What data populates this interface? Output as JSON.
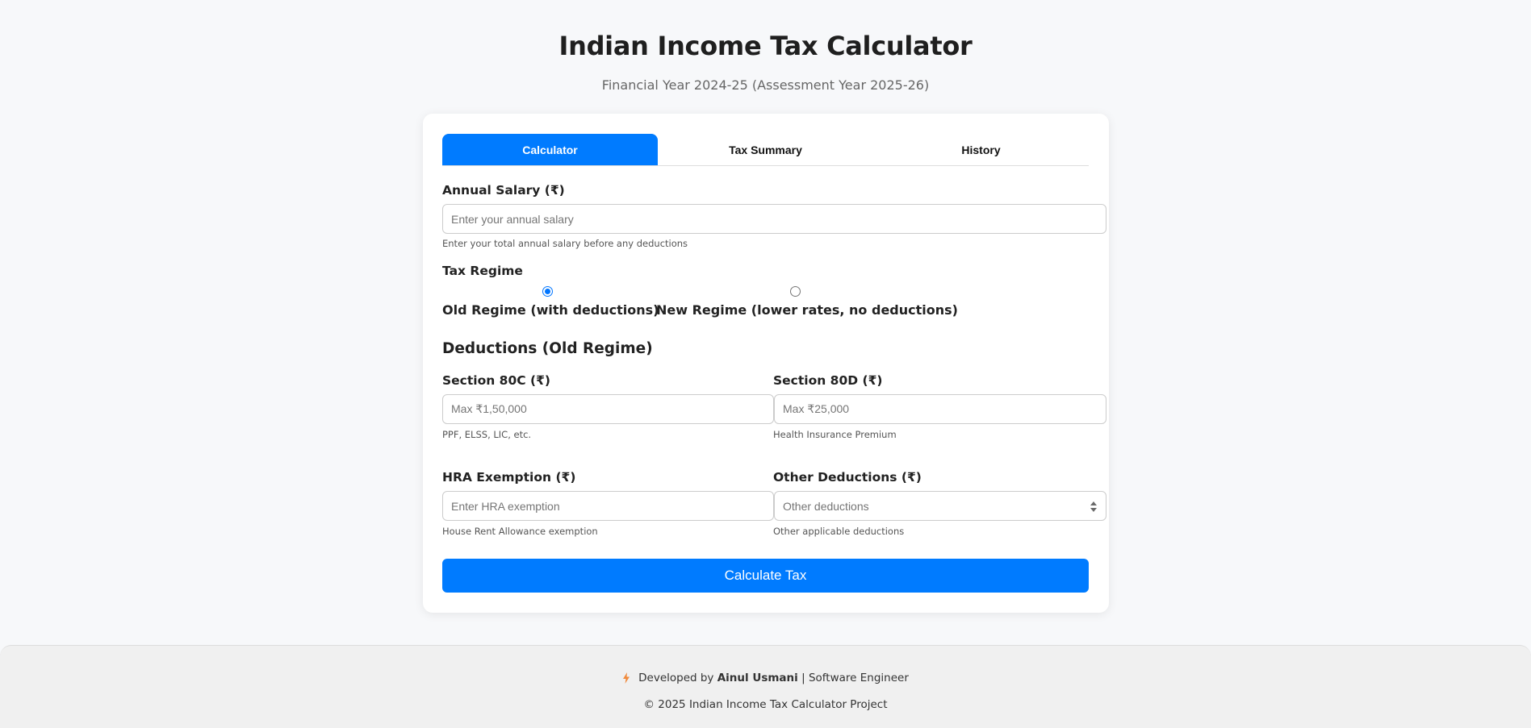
{
  "header": {
    "title": "Indian Income Tax Calculator",
    "subtitle": "Financial Year 2024-25 (Assessment Year 2025-26)"
  },
  "tabs": [
    {
      "label": "Calculator",
      "active": true
    },
    {
      "label": "Tax Summary",
      "active": false
    },
    {
      "label": "History",
      "active": false
    }
  ],
  "salary": {
    "label": "Annual Salary (₹)",
    "placeholder": "Enter your annual salary",
    "help": "Enter your total annual salary before any deductions"
  },
  "regime": {
    "label": "Tax Regime",
    "options": [
      {
        "label": "Old Regime (with deductions)",
        "checked": true
      },
      {
        "label": "New Regime (lower rates, no deductions)",
        "checked": false
      }
    ]
  },
  "deductions": {
    "heading": "Deductions (Old Regime)",
    "section80c": {
      "label": "Section 80C (₹)",
      "placeholder": "Max ₹1,50,000",
      "help": "PPF, ELSS, LIC, etc."
    },
    "section80d": {
      "label": "Section 80D (₹)",
      "placeholder": "Max ₹25,000",
      "help": "Health Insurance Premium"
    },
    "hra": {
      "label": "HRA Exemption (₹)",
      "placeholder": "Enter HRA exemption",
      "help": "House Rent Allowance exemption"
    },
    "other": {
      "label": "Other Deductions (₹)",
      "placeholder": "Other deductions",
      "help": "Other applicable deductions"
    }
  },
  "actions": {
    "calculate_label": "Calculate Tax"
  },
  "footer": {
    "developed_by": "Developed by",
    "developer_name": "Ainul Usmani",
    "separator": "|",
    "role": "Software Engineer",
    "copyright": "© 2025 Indian Income Tax Calculator Project"
  },
  "colors": {
    "accent": "#007bff",
    "bolt_icon": "#f08a3c"
  },
  "icons": {
    "footer_icon": "lightning-bolt-icon",
    "select_icon": "up-down-arrows-icon"
  }
}
